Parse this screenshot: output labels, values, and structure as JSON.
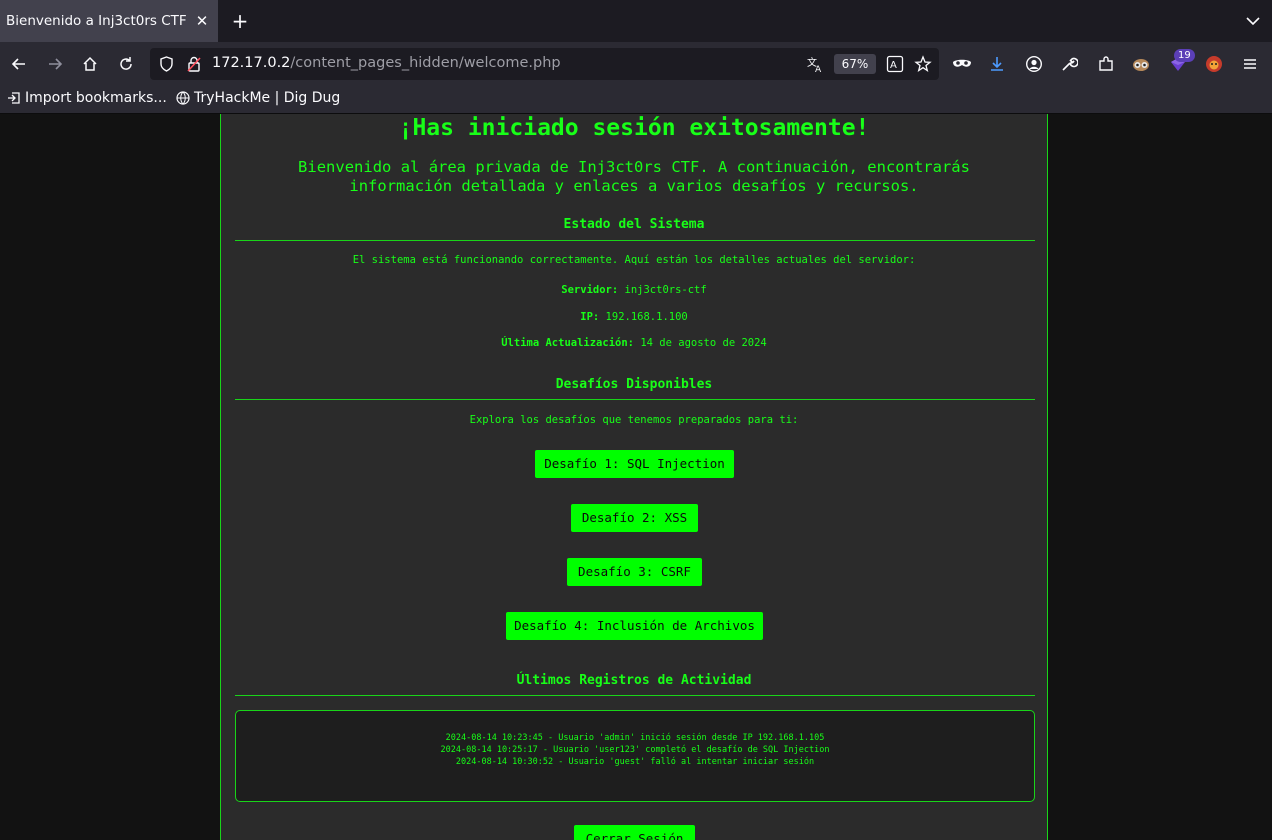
{
  "browser": {
    "tab_title": "Bienvenido a Inj3ct0rs CTF",
    "url_host": "172.17.0.2",
    "url_path": "/content_pages_hidden/welcome.php",
    "zoom": "67%",
    "extension_badge": "19",
    "bookmarks": [
      "Import bookmarks...",
      "TryHackMe | Dig Dug"
    ]
  },
  "page": {
    "heading": "¡Has iniciado sesión exitosamente!",
    "intro_line1": "Bienvenido al área privada de Inj3ct0rs CTF. A continuación, encontrarás",
    "intro_line2": "información detallada y enlaces a varios desafíos y recursos.",
    "status": {
      "title": "Estado del Sistema",
      "description": "El sistema está funcionando correctamente. Aquí están los detalles actuales del servidor:",
      "server_label": "Servidor:",
      "server_value": "inj3ct0rs-ctf",
      "ip_label": "IP:",
      "ip_value": "192.168.1.100",
      "updated_label": "Última Actualización:",
      "updated_value": "14 de agosto de 2024"
    },
    "challenges": {
      "title": "Desafíos Disponibles",
      "description": "Explora los desafíos que tenemos preparados para ti:",
      "items": [
        "Desafío 1: SQL Injection",
        "Desafío 2: XSS",
        "Desafío 3: CSRF",
        "Desafío 4: Inclusión de Archivos"
      ]
    },
    "logs": {
      "title": "Últimos Registros de Actividad",
      "lines": [
        "2024-08-14 10:23:45 - Usuario 'admin' inició sesión desde IP 192.168.1.105",
        "2024-08-14 10:25:17 - Usuario 'user123' completó el desafío de SQL Injection",
        "2024-08-14 10:30:52 - Usuario 'guest' falló al intentar iniciar sesión"
      ]
    },
    "logout_label": "Cerrar Sesión"
  }
}
